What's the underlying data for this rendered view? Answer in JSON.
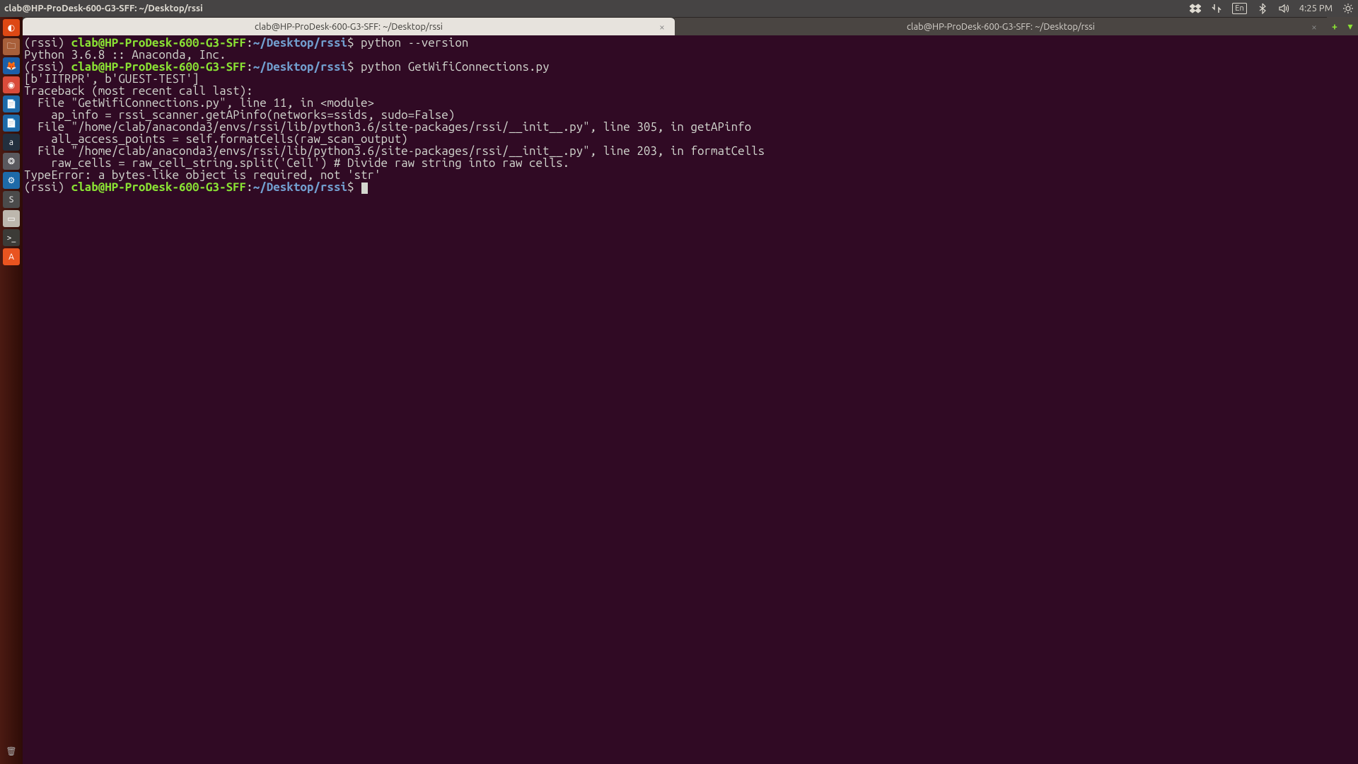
{
  "top_panel": {
    "window_title": "clab@HP-ProDesk-600-G3-SFF: ~/Desktop/rssi",
    "lang_indicator": "En",
    "clock": "4:25 PM"
  },
  "launcher_items": [
    {
      "name": "dash-icon",
      "bg": "#dd4814",
      "glyph": "◐"
    },
    {
      "name": "files-icon",
      "bg": "#a85f3a",
      "glyph": "🗀"
    },
    {
      "name": "firefox-icon",
      "bg": "#1c5fa8",
      "glyph": "🦊"
    },
    {
      "name": "chrome-icon",
      "bg": "#d94b3a",
      "glyph": "◉"
    },
    {
      "name": "doc-icon",
      "bg": "#1e6aa8",
      "glyph": "📄"
    },
    {
      "name": "doc2-icon",
      "bg": "#1e6aa8",
      "glyph": "📄"
    },
    {
      "name": "amazon-icon",
      "bg": "#232f3e",
      "glyph": "a"
    },
    {
      "name": "swirl-icon",
      "bg": "#5a595e",
      "glyph": "❂"
    },
    {
      "name": "gear-icon",
      "bg": "#1e6aa8",
      "glyph": "⚙"
    },
    {
      "name": "sublime-icon",
      "bg": "#4b4b4b",
      "glyph": "S"
    },
    {
      "name": "panel-icon",
      "bg": "#bdb7ad",
      "glyph": "▭"
    },
    {
      "name": "terminal-icon",
      "bg": "#3c3b37",
      "glyph": ">_"
    },
    {
      "name": "software-icon",
      "bg": "#e95420",
      "glyph": "A"
    }
  ],
  "launcher_trash": {
    "name": "trash-icon",
    "bg": "transparent",
    "glyph": "🗑"
  },
  "tabs": [
    {
      "title": "clab@HP-ProDesk-600-G3-SFF: ~/Desktop/rssi",
      "active": true
    },
    {
      "title": "clab@HP-ProDesk-600-G3-SFF: ~/Desktop/rssi",
      "active": false
    }
  ],
  "prompt": {
    "env": "(rssi) ",
    "userhost": "clab@HP-ProDesk-600-G3-SFF",
    "colon": ":",
    "path": "~/Desktop/rssi",
    "dollar": "$"
  },
  "terminal_lines": [
    {
      "type": "prompt",
      "cmd": " python --version"
    },
    {
      "type": "out",
      "text": "Python 3.6.8 :: Anaconda, Inc."
    },
    {
      "type": "prompt",
      "cmd": " python GetWifiConnections.py"
    },
    {
      "type": "out",
      "text": "[b'IITRPR', b'GUEST-TEST']"
    },
    {
      "type": "out",
      "text": "Traceback (most recent call last):"
    },
    {
      "type": "out",
      "text": "  File \"GetWifiConnections.py\", line 11, in <module>"
    },
    {
      "type": "out",
      "text": "    ap_info = rssi_scanner.getAPinfo(networks=ssids, sudo=False)"
    },
    {
      "type": "out",
      "text": "  File \"/home/clab/anaconda3/envs/rssi/lib/python3.6/site-packages/rssi/__init__.py\", line 305, in getAPinfo"
    },
    {
      "type": "out",
      "text": "    all_access_points = self.formatCells(raw_scan_output)"
    },
    {
      "type": "out",
      "text": "  File \"/home/clab/anaconda3/envs/rssi/lib/python3.6/site-packages/rssi/__init__.py\", line 203, in formatCells"
    },
    {
      "type": "out",
      "text": "    raw_cells = raw_cell_string.split('Cell') # Divide raw string into raw cells."
    },
    {
      "type": "out",
      "text": "TypeError: a bytes-like object is required, not 'str'"
    },
    {
      "type": "prompt",
      "cmd": " ",
      "cursor": true
    }
  ]
}
